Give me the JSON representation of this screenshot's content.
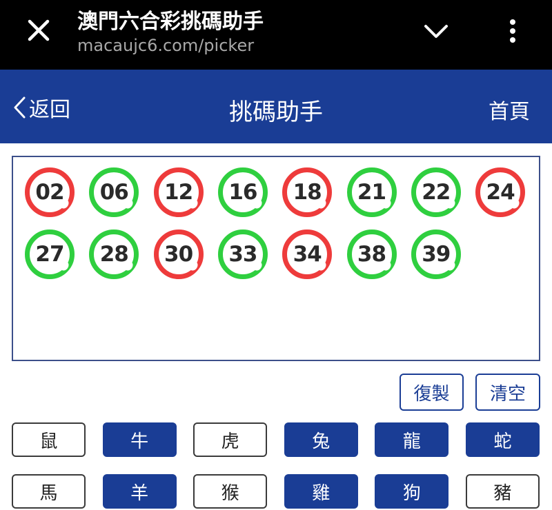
{
  "browser": {
    "title": "澳門六合彩挑碼助手",
    "url": "macaujc6.com/picker"
  },
  "header": {
    "back_label": "返回",
    "title": "挑碼助手",
    "home_label": "首頁"
  },
  "balls": [
    {
      "num": "02",
      "color": "red"
    },
    {
      "num": "06",
      "color": "green"
    },
    {
      "num": "12",
      "color": "red"
    },
    {
      "num": "16",
      "color": "green"
    },
    {
      "num": "18",
      "color": "red"
    },
    {
      "num": "21",
      "color": "green"
    },
    {
      "num": "22",
      "color": "green"
    },
    {
      "num": "24",
      "color": "red"
    },
    {
      "num": "27",
      "color": "green"
    },
    {
      "num": "28",
      "color": "green"
    },
    {
      "num": "30",
      "color": "red"
    },
    {
      "num": "33",
      "color": "green"
    },
    {
      "num": "34",
      "color": "red"
    },
    {
      "num": "38",
      "color": "green"
    },
    {
      "num": "39",
      "color": "green"
    }
  ],
  "actions": {
    "copy_label": "復製",
    "clear_label": "清空"
  },
  "zodiacs": [
    {
      "label": "鼠",
      "selected": false
    },
    {
      "label": "牛",
      "selected": true
    },
    {
      "label": "虎",
      "selected": false
    },
    {
      "label": "兔",
      "selected": true
    },
    {
      "label": "龍",
      "selected": true
    },
    {
      "label": "蛇",
      "selected": true
    },
    {
      "label": "馬",
      "selected": false
    },
    {
      "label": "羊",
      "selected": true
    },
    {
      "label": "猴",
      "selected": false
    },
    {
      "label": "雞",
      "selected": true
    },
    {
      "label": "狗",
      "selected": true
    },
    {
      "label": "豬",
      "selected": false
    }
  ],
  "colors": {
    "brand_blue": "#1a3d95",
    "ball_red": "#ee3b3b",
    "ball_green": "#2fcf3f"
  }
}
